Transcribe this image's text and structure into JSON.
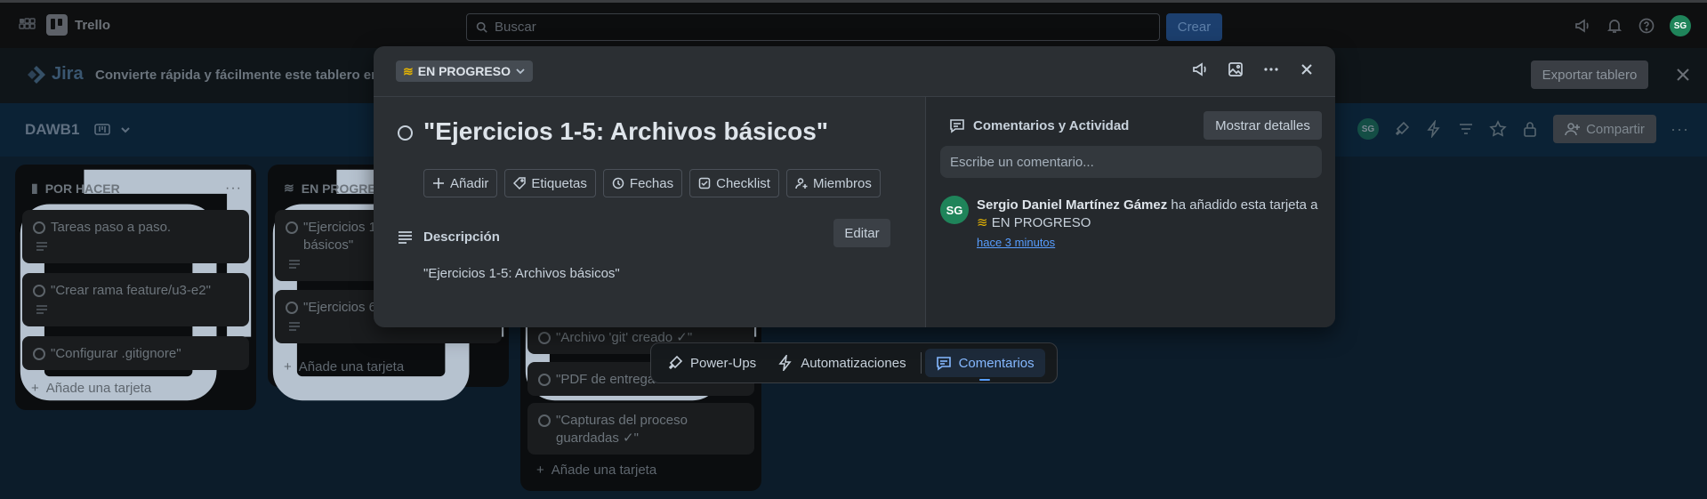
{
  "topbar": {
    "app_name": "Trello",
    "search_placeholder": "Buscar",
    "create_label": "Crear",
    "avatar_initials": "SG"
  },
  "banner": {
    "brand": "Jira",
    "text": "Convierte rápida y fácilmente este tablero en u",
    "export_label": "Exportar tablero"
  },
  "board": {
    "title": "DAWB1",
    "share_label": "Compartir",
    "member_initials": "SG",
    "lists": [
      {
        "title": "POR HACER",
        "cards": [
          "Tareas paso a paso.",
          "\"Crear rama feature/u3-e2\"",
          "\"Configurar .gitignore\""
        ],
        "add_label": "Añade una tarjeta"
      },
      {
        "title": "EN PROGRE",
        "cards": [
          "\"Ejercicios 1-5: Archivos básicos\"",
          "\"Ejercicios 6"
        ],
        "add_label": "Añade una tarjeta"
      },
      {
        "title": "",
        "cards": [
          "\"Archivo 'git' creado ✓\"",
          "\"PDF de entrega",
          "\"Capturas del proceso guardadas ✓\""
        ],
        "add_label": "Añade una tarjeta"
      }
    ]
  },
  "dock": {
    "powerups": "Power-Ups",
    "automations": "Automatizaciones",
    "comments": "Comentarios"
  },
  "modal": {
    "status": "EN PROGRESO",
    "title": "\"Ejercicios 1-5: Archivos básicos\"",
    "actions": [
      "Añadir",
      "Etiquetas",
      "Fechas",
      "Checklist",
      "Miembros"
    ],
    "description_label": "Descripción",
    "edit_label": "Editar",
    "description_text": "\"Ejercicios 1-5: Archivos básicos\"",
    "comments_title": "Comentarios y Actividad",
    "show_details_label": "Mostrar detalles",
    "comment_placeholder": "Escribe un comentario...",
    "activity": {
      "avatar_initials": "SG",
      "user": "Sergio Daniel Martínez Gámez",
      "action": " ha añadido esta tarjeta a",
      "target": "EN PROGRESO",
      "time": "hace 3 minutos"
    }
  },
  "colors": {
    "avatar_green": "#1f845a",
    "link_blue": "#579dff",
    "modal_bg": "#2b2f33"
  }
}
